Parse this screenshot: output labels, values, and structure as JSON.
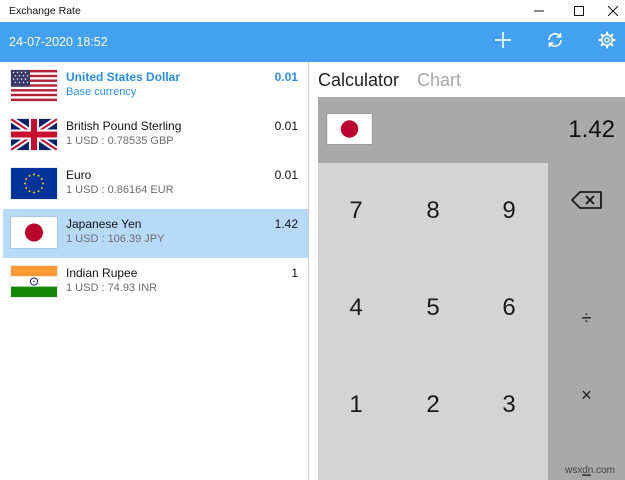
{
  "window": {
    "title": "Exchange Rate",
    "controls": [
      "minimize-icon",
      "maximize-icon",
      "close-icon"
    ]
  },
  "appbar": {
    "datetime": "24-07-2020 18:52",
    "actions": [
      "add-icon",
      "refresh-icon",
      "gear-icon"
    ],
    "color": "#43a1f2"
  },
  "currencies": [
    {
      "name": "United States Dollar",
      "sub": "Base currency",
      "rate": "0.01",
      "flag": "flag-usa",
      "base": true
    },
    {
      "name": "British Pound Sterling",
      "sub": "1 USD : 0.78535 GBP",
      "rate": "0.01",
      "flag": "flag-uk"
    },
    {
      "name": "Euro",
      "sub": "1 USD : 0.86164 EUR",
      "rate": "0.01",
      "flag": "flag-eu"
    },
    {
      "name": "Japanese Yen",
      "sub": "1 USD : 106.39 JPY",
      "rate": "1.42",
      "flag": "flag-japan",
      "selected": true
    },
    {
      "name": "Indian Rupee",
      "sub": "1 USD : 74.93 INR",
      "rate": "1",
      "flag": "flag-india"
    }
  ],
  "tabs": [
    {
      "label": "Calculator",
      "active": true
    },
    {
      "label": "Chart",
      "active": false
    }
  ],
  "calculator": {
    "display_value": "1.42",
    "display_flag": "flag-japan",
    "keys": [
      "7",
      "8",
      "9",
      "4",
      "5",
      "6",
      "1",
      "2",
      "3"
    ],
    "operators": [
      "backspace-icon",
      "÷",
      "×",
      "−"
    ]
  },
  "watermark": "wsxdn.com",
  "colors": {
    "selected_row": "#b7dafb",
    "base_currency": "#2d8ee8",
    "display_bg": "#a9a9a9",
    "keypad_bg": "#d4d4d4"
  }
}
